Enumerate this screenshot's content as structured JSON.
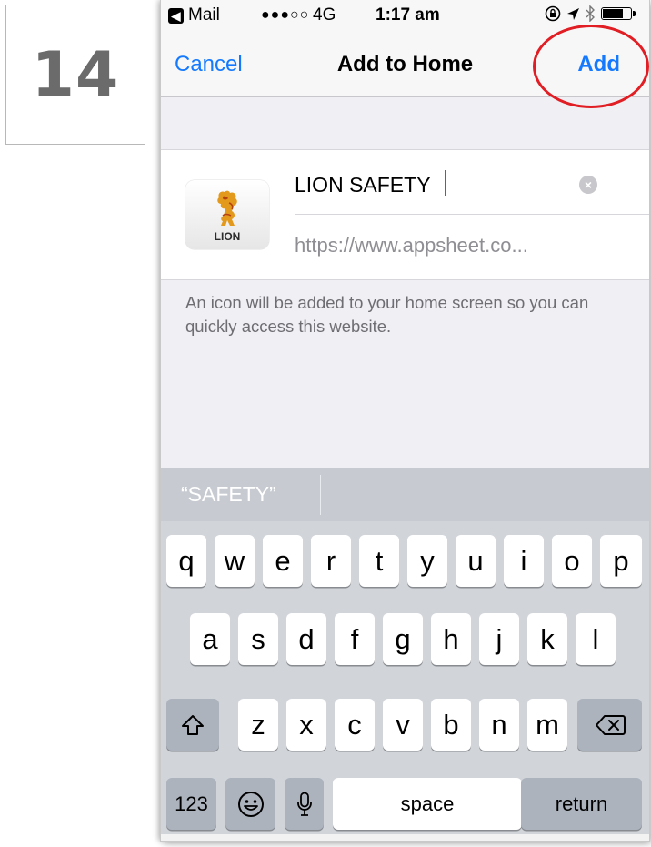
{
  "step_label": "14",
  "status_bar": {
    "back_app": "Mail",
    "signal": "●●●○○",
    "network": "4G",
    "time": "1:17 am"
  },
  "nav": {
    "cancel_label": "Cancel",
    "title": "Add to Home",
    "add_label": "Add"
  },
  "form": {
    "app_icon_brand": "LION",
    "title_value": "LION SAFETY",
    "url_value": "https://www.appsheet.co..."
  },
  "hint": "An icon will be added to your home screen so you can quickly access this website.",
  "keyboard": {
    "suggestion": "“SAFETY”",
    "row1": [
      "q",
      "w",
      "e",
      "r",
      "t",
      "y",
      "u",
      "i",
      "o",
      "p"
    ],
    "row2": [
      "a",
      "s",
      "d",
      "f",
      "g",
      "h",
      "j",
      "k",
      "l"
    ],
    "row3": [
      "z",
      "x",
      "c",
      "v",
      "b",
      "n",
      "m"
    ],
    "numbers_label": "123",
    "space_label": "space",
    "return_label": "return"
  },
  "colors": {
    "accent": "#1479ff",
    "highlight": "#e01e24"
  }
}
